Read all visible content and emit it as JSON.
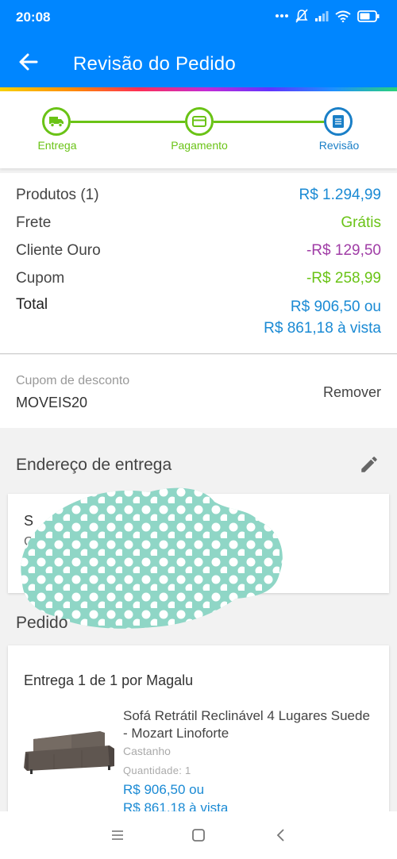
{
  "status_bar": {
    "time": "20:08"
  },
  "app_bar": {
    "title": "Revisão do Pedido"
  },
  "stepper": {
    "steps": [
      {
        "label": "Entrega",
        "icon": "truck-icon",
        "state": "done"
      },
      {
        "label": "Pagamento",
        "icon": "card-icon",
        "state": "done"
      },
      {
        "label": "Revisão",
        "icon": "document-icon",
        "state": "current"
      }
    ]
  },
  "summary": {
    "products_label": "Produtos (1)",
    "products_value": "R$ 1.294,99",
    "shipping_label": "Frete",
    "shipping_value": "Grátis",
    "gold_label": "Cliente Ouro",
    "gold_value": "-R$ 129,50",
    "coupon_label": "Cupom",
    "coupon_value": "-R$ 258,99",
    "total_label": "Total",
    "total_value": "R$ 906,50 ou",
    "total_cash": "R$ 861,18 à vista"
  },
  "coupon": {
    "label": "Cupom de desconto",
    "code": "MOVEIS20",
    "remove_label": "Remover"
  },
  "address": {
    "section_title": "Endereço de entrega",
    "line1": "S",
    "line2": "C"
  },
  "order": {
    "section_title": "Pedido",
    "delivery": "Entrega 1 de 1 por Magalu",
    "product_name": "Sofá Retrátil Reclinável 4 Lugares Suede - Mozart Linoforte",
    "color": "Castanho",
    "quantity": "Quantidade:  1",
    "price": "R$ 906,50 ou",
    "cash_price": "R$ 861,18 à vista"
  },
  "colors": {
    "primary": "#0086ff",
    "accent_green": "#6ac316",
    "price_blue": "#1a8ad4",
    "discount_purple": "#a03da6",
    "redaction_teal": "#8fd6c6"
  }
}
